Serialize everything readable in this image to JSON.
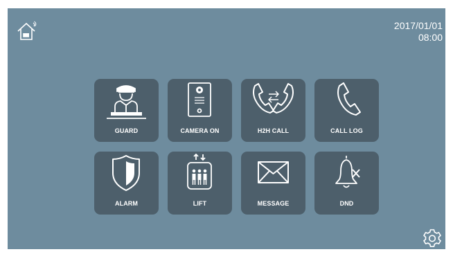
{
  "status": {
    "date": "2017/01/01",
    "time": "08:00"
  },
  "icons": {
    "home": "home-icon",
    "settings": "gear-icon"
  },
  "menu": [
    {
      "label": "GUARD",
      "icon": "guard-icon"
    },
    {
      "label": "CAMERA ON",
      "icon": "door-camera-icon"
    },
    {
      "label": "H2H CALL",
      "icon": "h2h-call-icon"
    },
    {
      "label": "CALL LOG",
      "icon": "phone-handset-icon"
    },
    {
      "label": "ALARM",
      "icon": "shield-icon"
    },
    {
      "label": "LIFT",
      "icon": "elevator-icon"
    },
    {
      "label": "MESSAGE",
      "icon": "envelope-icon"
    },
    {
      "label": "DND",
      "icon": "bell-muted-icon"
    }
  ],
  "colors": {
    "background": "#6e8c9e",
    "tile": "#4d5f6b",
    "icon": "#ffffff"
  }
}
